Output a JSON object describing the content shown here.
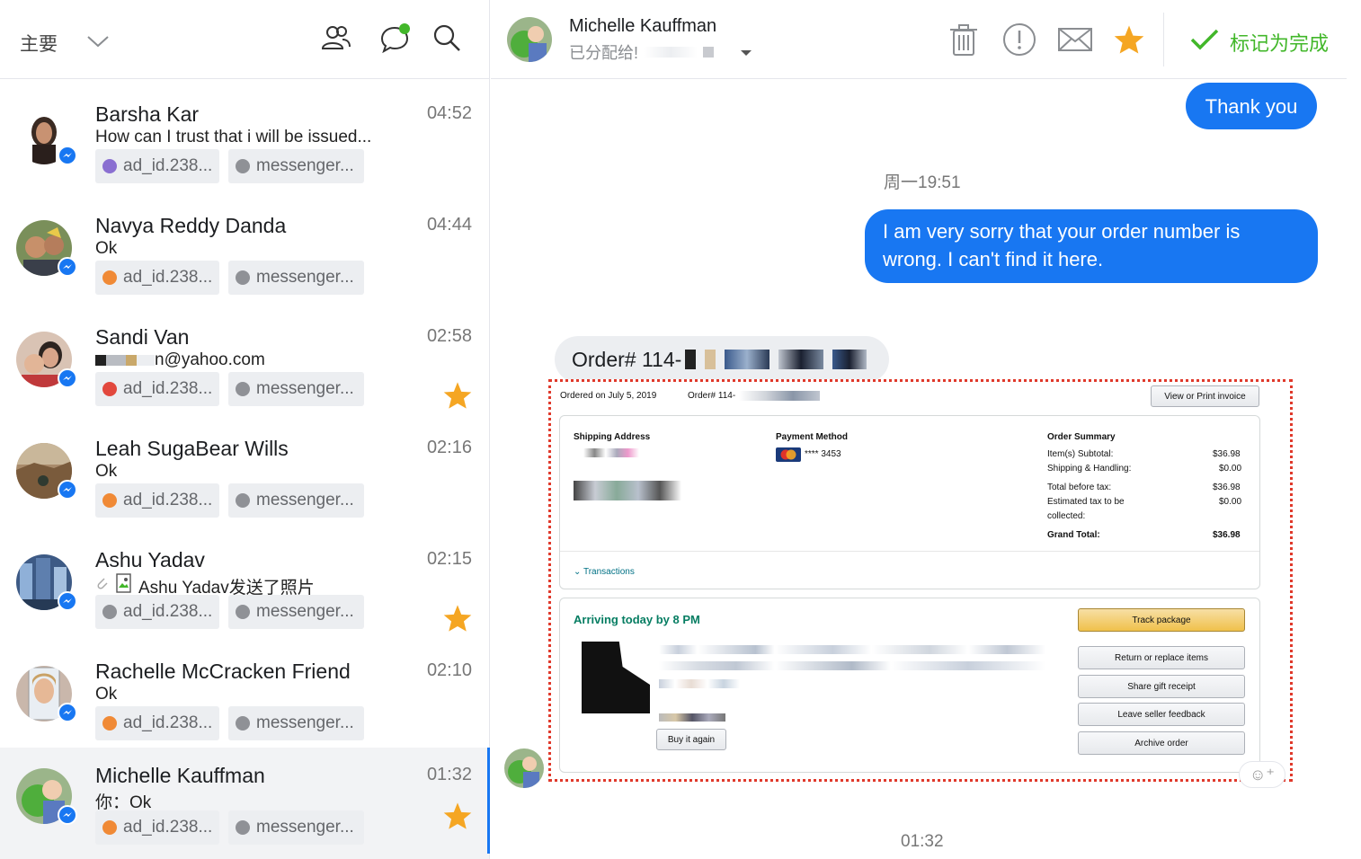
{
  "inbox": {
    "label": "主要",
    "icons": [
      "people-icon",
      "chat-bubble-icon",
      "search-icon"
    ]
  },
  "conversations": [
    {
      "name": "Barsha Kar",
      "time": "04:52",
      "snippet": "How can I trust that i will be issued...",
      "tag_ad": "ad_id.238...",
      "tag_ad_color": "#8a6fd1",
      "tag_ms": "messenger...",
      "starred": false
    },
    {
      "name": "Navya Reddy Danda",
      "time": "04:44",
      "snippet": "Ok",
      "tag_ad": "ad_id.238...",
      "tag_ad_color": "#f08a36",
      "tag_ms": "messenger...",
      "starred": false
    },
    {
      "name": "Sandi Van",
      "time": "02:58",
      "snippet": "n@yahoo.com",
      "tag_ad": "ad_id.238...",
      "tag_ad_color": "#e2483d",
      "tag_ms": "messenger...",
      "starred": true
    },
    {
      "name": "Leah SugaBear Wills",
      "time": "02:16",
      "snippet": "Ok",
      "tag_ad": "ad_id.238...",
      "tag_ad_color": "#f08a36",
      "tag_ms": "messenger...",
      "starred": false
    },
    {
      "name": "Ashu Yadav",
      "time": "02:15",
      "snippet": "Ashu Yadav发送了照片",
      "tag_ad": "ad_id.238...",
      "tag_ad_color": "#8f9196",
      "tag_ms": "messenger...",
      "starred": true
    },
    {
      "name": "Rachelle McCracken Friend",
      "time": "02:10",
      "snippet": "Ok",
      "tag_ad": "ad_id.238...",
      "tag_ad_color": "#f08a36",
      "tag_ms": "messenger...",
      "starred": false
    },
    {
      "name": "Michelle Kauffman",
      "time": "01:32",
      "snippet": "你：Ok",
      "tag_ad": "ad_id.238...",
      "tag_ad_color": "#f08a36",
      "tag_ms": "messenger...",
      "starred": true,
      "active": true
    }
  ],
  "chat": {
    "name": "Michelle Kauffman",
    "assigned_to": "已分配给!",
    "mark_done": "标记为完成",
    "actions": [
      "trash-icon",
      "alert-icon",
      "mail-icon",
      "star-icon"
    ],
    "messages": {
      "out1": "Thank you",
      "ts1": "周一19:51",
      "out2": "I am very sorry that your order number is wrong. I can't find it here.",
      "in1": "Order# 114-",
      "ts2": "01:32"
    }
  },
  "order_card": {
    "ordered_on": "Ordered on July 5, 2019",
    "order_no": "Order# 114-",
    "view_invoice": "View or Print invoice",
    "shipping_address": "Shipping Address",
    "payment_method": "Payment Method",
    "card_last4": "**** 3453",
    "order_summary": "Order Summary",
    "summary_rows": [
      {
        "label": "Item(s) Subtotal:",
        "value": "$36.98"
      },
      {
        "label": "Shipping & Handling:",
        "value": "$0.00"
      },
      {
        "label": "Total before tax:",
        "value": "$36.98"
      },
      {
        "label": "Estimated tax to be",
        "value": "$0.00"
      },
      {
        "label": "collected:",
        "value": ""
      }
    ],
    "grand_total_label": "Grand Total:",
    "grand_total": "$36.98",
    "transactions": "Transactions",
    "arriving": "Arriving today by 8 PM",
    "track_package": "Track package",
    "return_replace": "Return or replace items",
    "share_gift": "Share gift receipt",
    "leave_feedback": "Leave seller feedback",
    "archive_order": "Archive order",
    "buy_again": "Buy it again"
  },
  "colors": {
    "accent": "#1877f2",
    "done_green": "#42b72a",
    "star_orange": "#f5a623",
    "highlight_red": "#e0392b"
  }
}
